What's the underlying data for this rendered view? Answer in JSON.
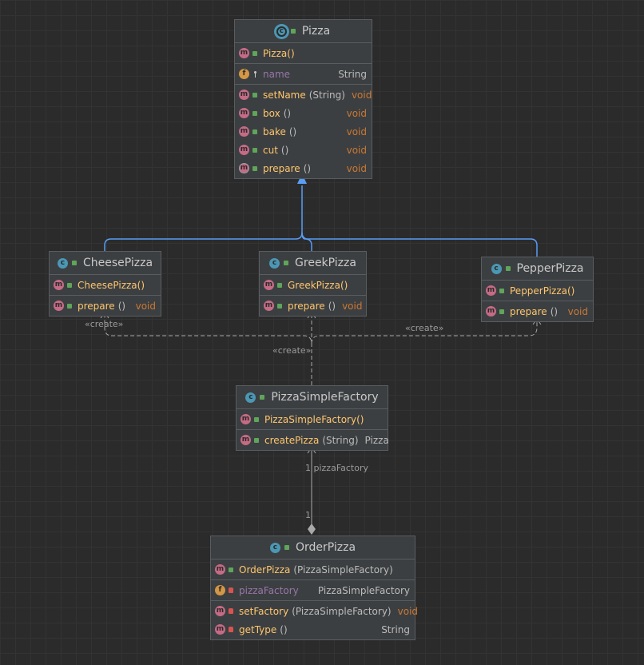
{
  "classes": {
    "pizza": {
      "title": "Pizza",
      "constructor": "Pizza()",
      "field": {
        "name": "name",
        "type": "String"
      },
      "methods": [
        {
          "name": "setName",
          "params": "(String)",
          "ret": "void"
        },
        {
          "name": "box",
          "params": "()",
          "ret": "void"
        },
        {
          "name": "bake",
          "params": "()",
          "ret": "void"
        },
        {
          "name": "cut",
          "params": "()",
          "ret": "void"
        },
        {
          "name": "prepare",
          "params": "()",
          "ret": "void"
        }
      ]
    },
    "cheese": {
      "title": "CheesePizza",
      "constructor": "CheesePizza()",
      "method": {
        "name": "prepare",
        "params": "()",
        "ret": "void"
      }
    },
    "greek": {
      "title": "GreekPizza",
      "constructor": "GreekPizza()",
      "method": {
        "name": "prepare",
        "params": "()",
        "ret": "void"
      }
    },
    "pepper": {
      "title": "PepperPizza",
      "constructor": "PepperPizza()",
      "method": {
        "name": "prepare",
        "params": "()",
        "ret": "void"
      }
    },
    "factory": {
      "title": "PizzaSimpleFactory",
      "constructor": "PizzaSimpleFactory()",
      "method": {
        "name": "createPizza",
        "params": "(String)",
        "ret": "Pizza"
      }
    },
    "order": {
      "title": "OrderPizza",
      "constructor": {
        "name": "OrderPizza",
        "params": "(PizzaSimpleFactory)"
      },
      "field": {
        "name": "pizzaFactory",
        "type": "PizzaSimpleFactory"
      },
      "methods": [
        {
          "name": "setFactory",
          "params": "(PizzaSimpleFactory)",
          "ret": "void"
        },
        {
          "name": "getType",
          "params": "()",
          "ret": "String"
        }
      ]
    }
  },
  "labels": {
    "create_cheese": "«create»",
    "create_pepper": "«create»",
    "create_greek": "«create»",
    "assoc_role": "1 pizzaFactory",
    "assoc_mult": "1"
  },
  "badges": {
    "method": "m",
    "field": "f",
    "class": "c"
  },
  "colors": {
    "background": "#2b2b2b",
    "node": "#3c3f41",
    "method_name": "#ffc66d",
    "field_name": "#9876aa",
    "return_type": "#cc7832",
    "inheritance_arrow": "#589df6"
  }
}
